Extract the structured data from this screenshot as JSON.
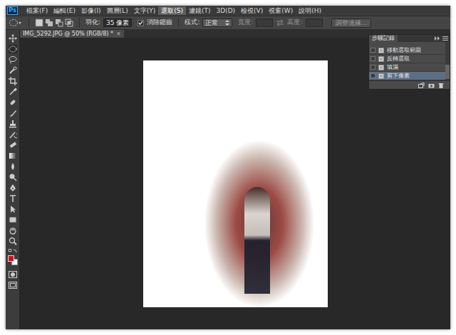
{
  "app": {
    "logo": "Ps"
  },
  "menu": [
    {
      "label": "檔案(F)",
      "selected": false
    },
    {
      "label": "編輯(E)",
      "selected": false
    },
    {
      "label": "影像(I)",
      "selected": false
    },
    {
      "label": "圖層(L)",
      "selected": false
    },
    {
      "label": "文字(Y)",
      "selected": false
    },
    {
      "label": "選取(S)",
      "selected": true
    },
    {
      "label": "濾鏡(T)",
      "selected": false
    },
    {
      "label": "3D(D)",
      "selected": false
    },
    {
      "label": "檢視(V)",
      "selected": false
    },
    {
      "label": "視窗(W)",
      "selected": false
    },
    {
      "label": "說明(H)",
      "selected": false
    }
  ],
  "options": {
    "feather_label": "羽化:",
    "feather_value": "35 像素",
    "antialias": {
      "label": "消除鋸齒",
      "checked": true
    },
    "style_label": "樣式:",
    "style_value": "正常",
    "width_label": "寬度:",
    "height_label": "高度:",
    "refine_button": "調整邊緣..."
  },
  "document_tab": {
    "title": "IMG_5292.JPG @ 50% (RGB/8) *",
    "close": "×"
  },
  "color_swatches": [
    {
      "color": "#e3001b"
    },
    {
      "color": "#ffffff"
    }
  ],
  "history": {
    "title": "步驟記錄",
    "items": [
      {
        "label": "移動選取範圍",
        "selected": false
      },
      {
        "label": "反轉選取",
        "selected": false
      },
      {
        "label": "填滿",
        "selected": false
      },
      {
        "label": "剪下像素",
        "selected": true
      }
    ]
  }
}
